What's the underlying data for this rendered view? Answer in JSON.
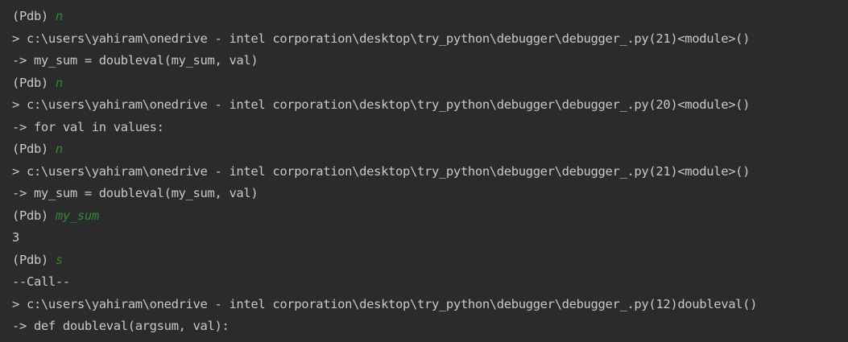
{
  "console": {
    "lines": [
      {
        "type": "prompt",
        "prompt": "(Pdb) ",
        "command": "n"
      },
      {
        "type": "output",
        "text": "> c:\\users\\yahiram\\onedrive - intel corporation\\desktop\\try_python\\debugger\\debugger_.py(21)<module>()"
      },
      {
        "type": "output",
        "text": "-> my_sum = doubleval(my_sum, val)"
      },
      {
        "type": "prompt",
        "prompt": "(Pdb) ",
        "command": "n"
      },
      {
        "type": "output",
        "text": "> c:\\users\\yahiram\\onedrive - intel corporation\\desktop\\try_python\\debugger\\debugger_.py(20)<module>()"
      },
      {
        "type": "output",
        "text": "-> for val in values:"
      },
      {
        "type": "prompt",
        "prompt": "(Pdb) ",
        "command": "n"
      },
      {
        "type": "output",
        "text": "> c:\\users\\yahiram\\onedrive - intel corporation\\desktop\\try_python\\debugger\\debugger_.py(21)<module>()"
      },
      {
        "type": "output",
        "text": "-> my_sum = doubleval(my_sum, val)"
      },
      {
        "type": "prompt",
        "prompt": "(Pdb) ",
        "command": "my_sum"
      },
      {
        "type": "output",
        "text": "3"
      },
      {
        "type": "prompt",
        "prompt": "(Pdb) ",
        "command": "s"
      },
      {
        "type": "output",
        "text": "--Call--"
      },
      {
        "type": "output",
        "text": "> c:\\users\\yahiram\\onedrive - intel corporation\\desktop\\try_python\\debugger\\debugger_.py(12)doubleval()"
      },
      {
        "type": "output",
        "text": "-> def doubleval(argsum, val):"
      }
    ]
  },
  "colors": {
    "background": "#2b2b2b",
    "text": "#c9c9c9",
    "command": "#2e8b2e"
  }
}
